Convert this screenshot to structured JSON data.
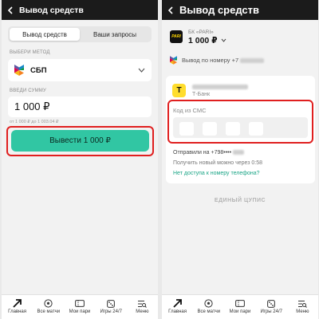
{
  "left": {
    "title": "Вывод средств",
    "tabs": [
      {
        "label": "Вывод средств"
      },
      {
        "label": "Ваши запросы"
      }
    ],
    "method_label": "ВЫБЕРИ МЕТОД",
    "method_name": "СБП",
    "sum_label": "ВВЕДИ СУММУ",
    "amount": "1 000 ₽",
    "amount_hint": "от 1 000 ₽ до 1 003.04 ₽",
    "withdraw_button": "Вывести 1 000 ₽"
  },
  "right": {
    "title": "Вывод средств",
    "bk_logo": "PARI",
    "bk_name": "БК «PARI»",
    "bk_amount": "1 000 ₽",
    "phone_prefix": "Вывод по номеру +7",
    "bank_logo": "T",
    "bank_name": "Т-Банк",
    "sms_label": "Код из СМС",
    "sent_prefix": "Отправили на +798",
    "sent_mask": "••••",
    "new_code_text": "Получить новый можно через 0:58",
    "no_access_link": "Нет доступа к номеру телефона?",
    "unified_text": "ЕДИНЫЙ ЦУПИС"
  },
  "nav": [
    {
      "label": "Главная",
      "icon": "arrow-icon"
    },
    {
      "label": "Все матчи",
      "icon": "ball-icon"
    },
    {
      "label": "Мои пари",
      "icon": "ticket-icon"
    },
    {
      "label": "Игры 24/7",
      "icon": "dice-icon"
    },
    {
      "label": "Меню",
      "icon": "menu-icon"
    }
  ],
  "colors": {
    "header_bg": "#1b1b1b",
    "accent_green": "#31c6a3",
    "highlight_red": "#e01f1f",
    "bank_yellow": "#ffdd2d",
    "link_green": "#1aa586"
  }
}
